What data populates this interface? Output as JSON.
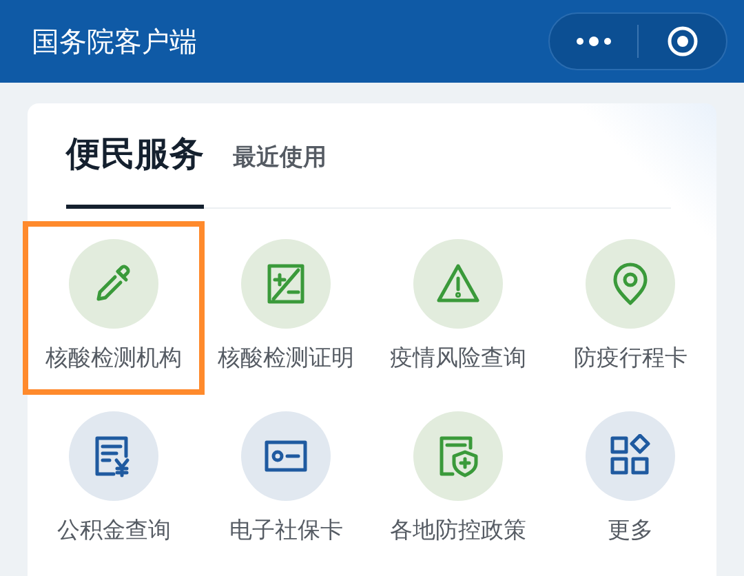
{
  "header": {
    "title": "国务院客户端"
  },
  "tabs": [
    {
      "label": "便民服务",
      "selected": true
    },
    {
      "label": "最近使用",
      "selected": false
    }
  ],
  "services": [
    {
      "kind": "dropper",
      "label": "核酸检测机构",
      "color": "#3a9a3a",
      "highlighted": true
    },
    {
      "kind": "plusminus",
      "label": "核酸检测证明",
      "color": "#3a9a3a",
      "highlighted": false
    },
    {
      "kind": "warning",
      "label": "疫情风险查询",
      "color": "#3a9a3a",
      "highlighted": false
    },
    {
      "kind": "pin",
      "label": "防疫行程卡",
      "color": "#3a9a3a",
      "highlighted": false
    },
    {
      "kind": "yen",
      "label": "公积金查询",
      "color": "#1f5aa0",
      "highlighted": false
    },
    {
      "kind": "card",
      "label": "电子社保卡",
      "color": "#1f5aa0",
      "highlighted": false
    },
    {
      "kind": "shield",
      "label": "各地防控政策",
      "color": "#3a9a3a",
      "highlighted": false
    },
    {
      "kind": "grid",
      "label": "更多",
      "color": "#1f5aa0",
      "highlighted": false
    }
  ]
}
